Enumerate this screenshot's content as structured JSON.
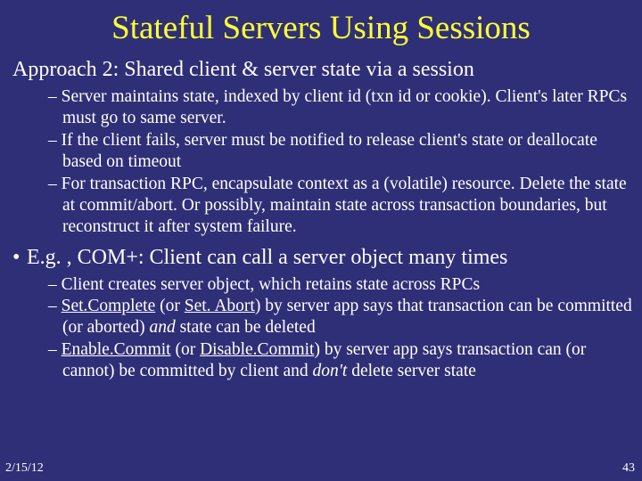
{
  "title": "Stateful Servers Using Sessions",
  "approach": "Approach 2: Shared client & server state via a session",
  "sub1": {
    "a": "Server maintains state, indexed by client id (txn id or cookie). Client's later RPCs must go to same server.",
    "b": "If the client fails, server must be notified to release client's state or deallocate based on timeout",
    "c": "For transaction RPC, encapsulate context as a (volatile) resource. Delete the state at commit/abort. Or possibly, maintain state across transaction boundaries, but reconstruct it after system failure."
  },
  "eg": "E.g. , COM+: Client can call a server object many times",
  "sub2": {
    "a": "Client creates server object, which retains state across RPCs",
    "b_pre": "Set.Complete",
    "b_mid1": " (or ",
    "b_setabort": "Set. Abort",
    "b_mid2": ") by server app says that transaction can be committed (or aborted) ",
    "b_and": "and",
    "b_post": " state can be deleted",
    "c_enable": "Enable.Commit",
    "c_mid1": " (or ",
    "c_disable": "Disable.Commit",
    "c_mid2": ") by server app says transaction can (or cannot) be committed by client and ",
    "c_dont": "don't",
    "c_post": " delete server state"
  },
  "footer": {
    "date": "2/15/12",
    "page": "43"
  },
  "bullet_char": "•",
  "dash_char": "– "
}
